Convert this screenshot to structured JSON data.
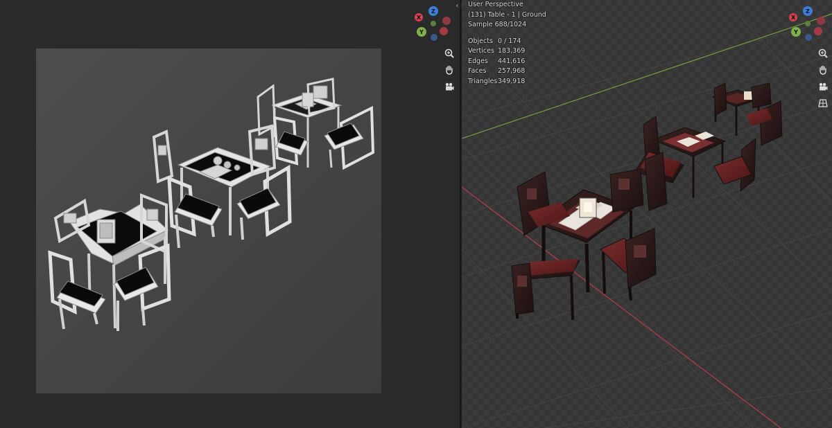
{
  "viewport_right": {
    "view_name": "User Perspective",
    "active_object": "(131) Table - 1 | Ground",
    "sample": "Sample 688/1024",
    "stats": [
      {
        "label": "Objects",
        "value": "0 / 174"
      },
      {
        "label": "Vertices",
        "value": "183,369"
      },
      {
        "label": "Edges",
        "value": "441,616"
      },
      {
        "label": "Faces",
        "value": "257,968"
      },
      {
        "label": "Triangles",
        "value": "349,918"
      }
    ]
  },
  "gizmo": {
    "axis_z": "Z",
    "axis_x": "X",
    "axis_y": "Y",
    "colors": {
      "x_axis": "#d5424f",
      "y_axis": "#7fb04a",
      "z_axis": "#3b7fd8",
      "x_axis_neg": "#8c3a40",
      "y_axis_neg": "#5d7f3c",
      "z_axis_neg": "#3a5a8c"
    }
  },
  "toolbar_icons": [
    "zoom-icon",
    "hand-pan-icon",
    "camera-icon",
    "grid-ortho-icon"
  ],
  "area_split_label": "‹ ›",
  "colors": {
    "viewport_left_bg": "#2a2a2a",
    "viewport_right_bg": "#333333",
    "x_axis_line": "#b83b4a",
    "y_axis_line": "#7a9a3a",
    "grid_line": "#3f3f3f"
  }
}
